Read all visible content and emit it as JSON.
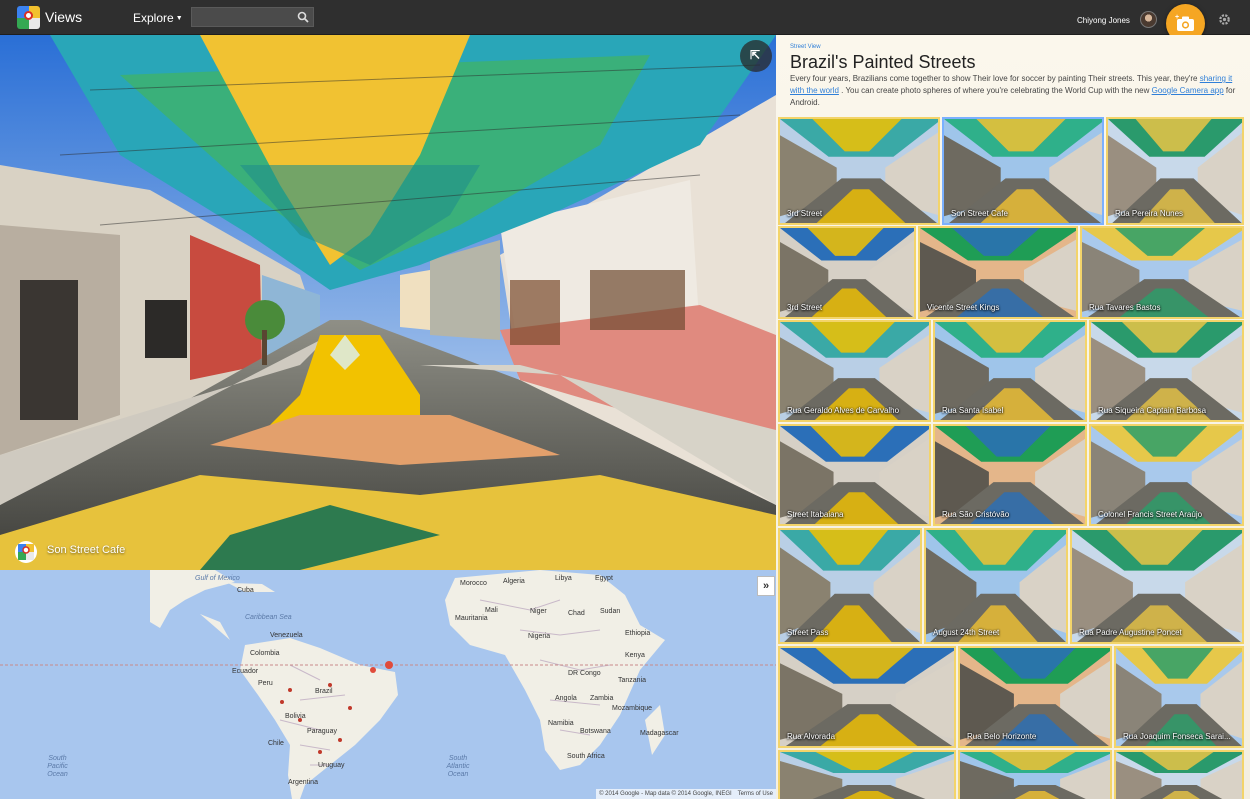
{
  "header": {
    "app_name": "Views",
    "explore_label": "Explore",
    "search_value": "",
    "user_name": "Chiyong Jones"
  },
  "street_view": {
    "caption": "Son Street Cafe"
  },
  "map": {
    "labels": [
      "Gulf of Mexico",
      "Cuba",
      "Caribbean Sea",
      "Venezuela",
      "Colombia",
      "Ecuador",
      "Peru",
      "Brazil",
      "Bolivia",
      "Paraguay",
      "Chile",
      "Uruguay",
      "Argentina",
      "South Pacific Ocean",
      "South Atlantic Ocean",
      "Algeria",
      "Libya",
      "Egypt",
      "Mali",
      "Niger",
      "Chad",
      "Sudan",
      "Nigeria",
      "Ethiopia",
      "Kenya",
      "Tanzania",
      "DR Congo",
      "Angola",
      "Namibia",
      "Botswana",
      "South Africa",
      "Madagascar",
      "Mozambique",
      "Zambia",
      "Mauritania",
      "Morocco"
    ],
    "footer": "© 2014 Google - Map data © 2014 Google, INEGI",
    "terms": "Terms of Use"
  },
  "panel": {
    "kicker": "Street View",
    "title": "Brazil's Painted Streets",
    "desc_1": "Every four years, Brazilians come together to show Their love for soccer by painting Their streets. This year, they're",
    "link_1": "sharing it with the world",
    "desc_2": ". You can create photo spheres of where you're celebrating the World Cup with the new",
    "link_2": "Google Camera app",
    "desc_3": "for Android.",
    "thumbnails": [
      "3rd Street",
      "Son Street Cafe",
      "Rua Pereira Nunes",
      "3rd Street",
      "Vicente Street Kings",
      "Rua Tavares Bastos",
      "Rua Geraldo Alves de Carvalho",
      "Rua Santa Isabel",
      "Rua Siqueira Captain Barbosa",
      "Street Itabaiana",
      "Rua São Cristóvão",
      "Colonel Francis Street Araújo",
      "Street Pass",
      "August 24th Street",
      "Rua Padre Augustine Poncet",
      "Rua Alvorada",
      "Rua Belo Horizonte",
      "Rua Joaquim Fonseca Sarai...",
      "",
      "",
      ""
    ]
  },
  "colors": {
    "brazil_green": "#1f9d55",
    "brazil_yellow": "#f2c200",
    "brazil_blue": "#1f5fb8",
    "camera_orange": "#f5a623",
    "link_blue": "#2f7fd8"
  }
}
